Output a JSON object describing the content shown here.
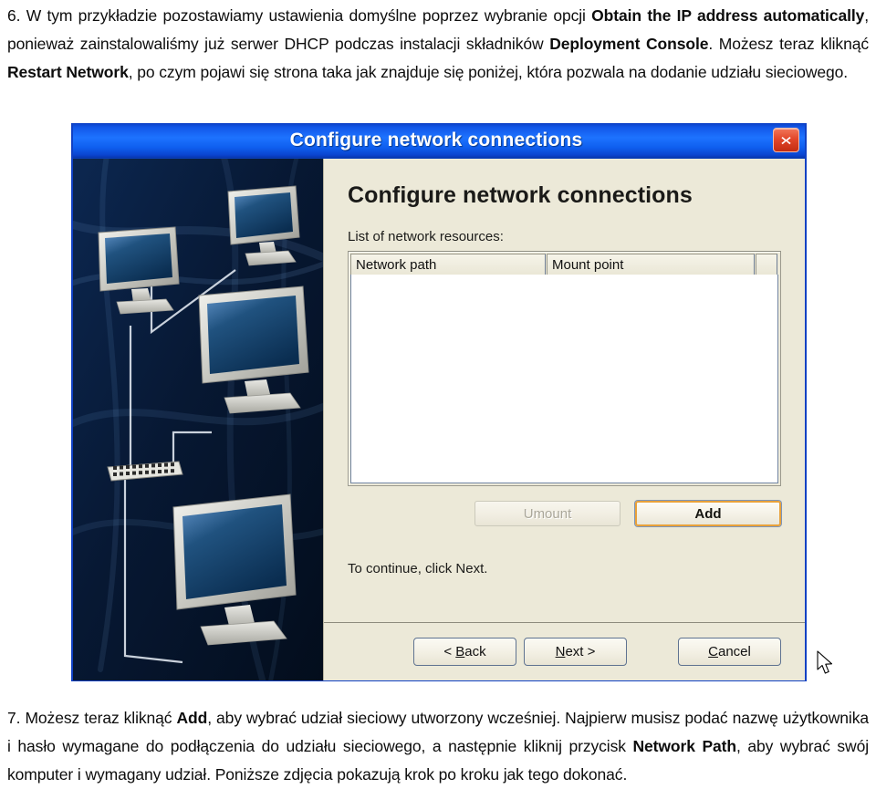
{
  "document": {
    "paragraph_top_html": "6. W tym przykładzie pozostawiamy ustawienia domyślne poprzez wybranie opcji <b>Obtain the IP address automatically</b>, ponieważ zainstalowaliśmy już serwer DHCP podczas instalacji składników <b>Deployment Console</b>. Możesz teraz kliknąć <b>Restart Network</b>, po czym pojawi się strona taka jak znajduje się poniżej, która pozwala na dodanie udziału sieciowego.",
    "paragraph_bottom_html": "7. Możesz teraz kliknąć <b>Add</b>, aby wybrać udział sieciowy utworzony wcześniej. Najpierw musisz podać nazwę użytkownika i hasło wymagane do podłączenia do udziału sieciowego, a następnie kliknij przycisk <b>Network Path</b>, aby wybrać swój komputer i wymagany udział. Poniższe zdjęcia pokazują krok po kroku jak tego dokonać."
  },
  "dialog": {
    "titlebar": {
      "title": "Configure network connections",
      "close_icon": "close-icon"
    },
    "heading": "Configure network connections",
    "list_label": "List of network resources:",
    "columns": [
      {
        "label": "Network path"
      },
      {
        "label": "Mount point"
      },
      {
        "label": ""
      }
    ],
    "rows": [],
    "actions": {
      "umount_label": "Umount",
      "umount_enabled": false,
      "add_label": "Add",
      "add_focused": true
    },
    "continue_text": "To continue, click Next.",
    "footer": {
      "back_label": "< Back",
      "back_accel": "B",
      "next_label": "Next >",
      "next_accel": "N",
      "cancel_label": "Cancel",
      "cancel_accel": "C"
    },
    "sidebar_illustration": "network-monitors-illustration",
    "cursor": "mouse-pointer-arrow"
  },
  "colors": {
    "titlebar_blue": "#1d73ff",
    "window_border": "#1041c4",
    "dialog_face": "#ece9d8",
    "close_red": "#e2472a",
    "focus_orange": "#e8a13a",
    "panel_dark_blue": "#061530"
  }
}
